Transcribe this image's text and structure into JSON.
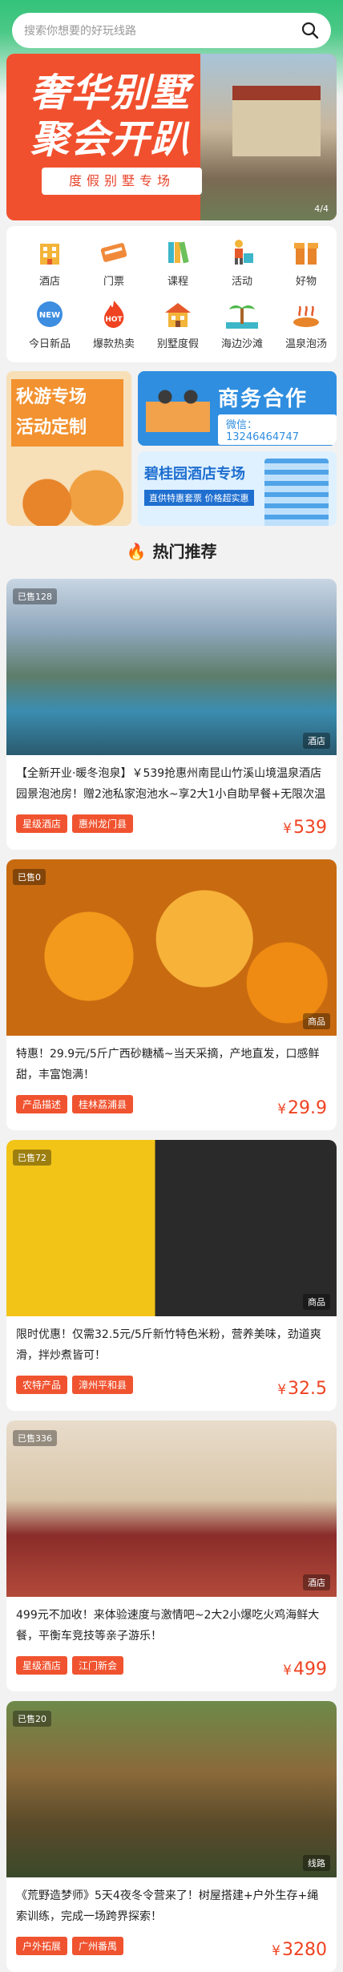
{
  "search": {
    "placeholder": "搜索你想要的好玩线路"
  },
  "banner": {
    "title_line1": "奢华别墅",
    "title_line2": "聚会开趴",
    "subtitle": "度假别墅专场",
    "counter": "4/4"
  },
  "categories": [
    {
      "label": "酒店",
      "icon": "hotel-icon"
    },
    {
      "label": "门票",
      "icon": "ticket-icon"
    },
    {
      "label": "课程",
      "icon": "books-icon"
    },
    {
      "label": "活动",
      "icon": "activity-icon"
    },
    {
      "label": "好物",
      "icon": "gift-box-icon"
    },
    {
      "label": "今日新品",
      "icon": "new-badge-icon"
    },
    {
      "label": "爆款热卖",
      "icon": "hot-fire-icon"
    },
    {
      "label": "别墅度假",
      "icon": "villa-icon"
    },
    {
      "label": "海边沙滩",
      "icon": "palm-beach-icon"
    },
    {
      "label": "温泉泡汤",
      "icon": "hot-spring-icon"
    }
  ],
  "promos": {
    "autumn": {
      "line1": "秋游专场",
      "line2": "活动定制"
    },
    "business": {
      "title": "商务合作",
      "wechat": "微信：13246464747"
    },
    "hotel": {
      "title": "碧桂园酒店专场",
      "sub": "直供特惠套票 价格超实惠"
    }
  },
  "section": {
    "title": "热门推荐"
  },
  "products": [
    {
      "sold": "已售128",
      "kind": "酒店",
      "desc": "【全新开业·暖冬泡泉】￥539抢惠州南昆山竹溪山境温泉酒店园景泡池房！赠2池私家泡池水~享2大1小自助早餐+无限次温泉…",
      "tags": [
        "星级酒店",
        "惠州龙门县"
      ],
      "price": "539",
      "currency": "¥"
    },
    {
      "sold": "已售0",
      "kind": "商品",
      "desc": "特惠！29.9元/5斤广西砂糖橘~当天采摘，产地直发，口感鲜甜，丰富饱满！",
      "tags": [
        "产品描述",
        "桂林荔浦县"
      ],
      "price": "29.9",
      "currency": "¥"
    },
    {
      "sold": "已售72",
      "kind": "商品",
      "desc": "限时优惠！仅需32.5元/5斤新竹特色米粉，营养美味，劲道爽滑，拌炒煮皆可！",
      "tags": [
        "农特产品",
        "漳州平和县"
      ],
      "price": "32.5",
      "currency": "¥"
    },
    {
      "sold": "已售336",
      "kind": "酒店",
      "desc": "499元不加收！来体验速度与激情吧~2大2小爆吃火鸡海鲜大餐，平衡车竞技等亲子游乐！",
      "tags": [
        "星级酒店",
        "江门新会"
      ],
      "price": "499",
      "currency": "¥"
    },
    {
      "sold": "已售20",
      "kind": "线路",
      "desc": "《荒野造梦师》5天4夜冬令营来了！树屋搭建+户外生存+绳索训练，完成一场跨界探索！",
      "tags": [
        "户外拓展",
        "广州番禺"
      ],
      "price": "3280",
      "currency": "¥"
    }
  ]
}
